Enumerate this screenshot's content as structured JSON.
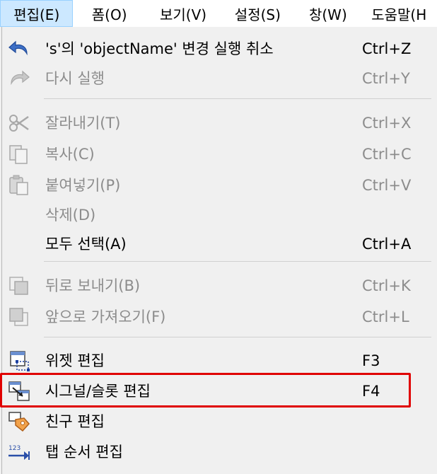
{
  "menubar": {
    "items": [
      {
        "label": "편집(E)"
      },
      {
        "label": "폼(O)"
      },
      {
        "label": "보기(V)"
      },
      {
        "label": "설정(S)"
      },
      {
        "label": "창(W)"
      },
      {
        "label": "도움말(H"
      }
    ]
  },
  "edit_menu": {
    "items": [
      {
        "label": "'s'의 'objectName' 변경 실행 취소",
        "shortcut": "Ctrl+Z",
        "icon": "undo-icon",
        "enabled": true
      },
      {
        "label": "다시 실행",
        "shortcut": "Ctrl+Y",
        "icon": "redo-icon",
        "enabled": false
      },
      {
        "label": "잘라내기(T)",
        "shortcut": "Ctrl+X",
        "icon": "scissors-icon",
        "enabled": false
      },
      {
        "label": "복사(C)",
        "shortcut": "Ctrl+C",
        "icon": "copy-icon",
        "enabled": false
      },
      {
        "label": "붙여넣기(P)",
        "shortcut": "Ctrl+V",
        "icon": "paste-icon",
        "enabled": false
      },
      {
        "label": "삭제(D)",
        "shortcut": "",
        "icon": "",
        "enabled": false
      },
      {
        "label": "모두 선택(A)",
        "shortcut": "Ctrl+A",
        "icon": "",
        "enabled": true
      },
      {
        "label": "뒤로 보내기(B)",
        "shortcut": "Ctrl+K",
        "icon": "send-back-icon",
        "enabled": false
      },
      {
        "label": "앞으로 가져오기(F)",
        "shortcut": "Ctrl+L",
        "icon": "bring-front-icon",
        "enabled": false
      },
      {
        "label": "위젯 편집",
        "shortcut": "F3",
        "icon": "widget-edit-icon",
        "enabled": true
      },
      {
        "label": "시그널/슬롯 편집",
        "shortcut": "F4",
        "icon": "signal-slot-icon",
        "enabled": true
      },
      {
        "label": "친구 편집",
        "shortcut": "",
        "icon": "buddy-edit-icon",
        "enabled": true
      },
      {
        "label": "탭 순서 편집",
        "shortcut": "",
        "icon": "tab-order-icon",
        "enabled": true
      }
    ]
  },
  "colors": {
    "menubar_active": "#cce8ff",
    "disabled_text": "#8c8c8c",
    "highlight_border": "#e00000"
  }
}
